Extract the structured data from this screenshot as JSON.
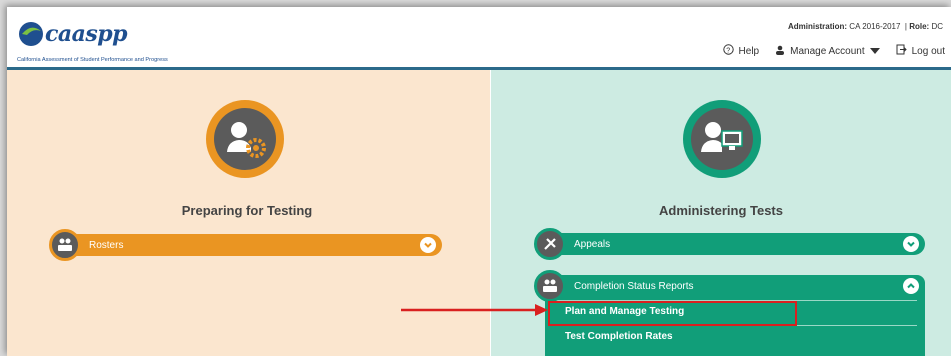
{
  "header": {
    "logo_text": "caaspp",
    "logo_subtitle": "California Assessment of Student Performance and Progress",
    "admin_label": "Administration:",
    "admin_value": "CA 2016-2017",
    "role_label": "Role:",
    "role_value": "DC",
    "nav": {
      "help": "Help",
      "manage_account": "Manage Account",
      "logout": "Log out"
    }
  },
  "left_panel": {
    "title": "Preparing for Testing",
    "bar": {
      "label": "Rosters"
    }
  },
  "right_panel": {
    "title": "Administering Tests",
    "bars": [
      {
        "label": "Appeals"
      },
      {
        "label": "Completion Status Reports"
      }
    ],
    "dropdown_items": [
      "Plan and Manage Testing",
      "Test Completion Rates"
    ]
  },
  "colors": {
    "orange": "#ea9522",
    "green": "#119e79",
    "highlight": "#d9201f"
  }
}
